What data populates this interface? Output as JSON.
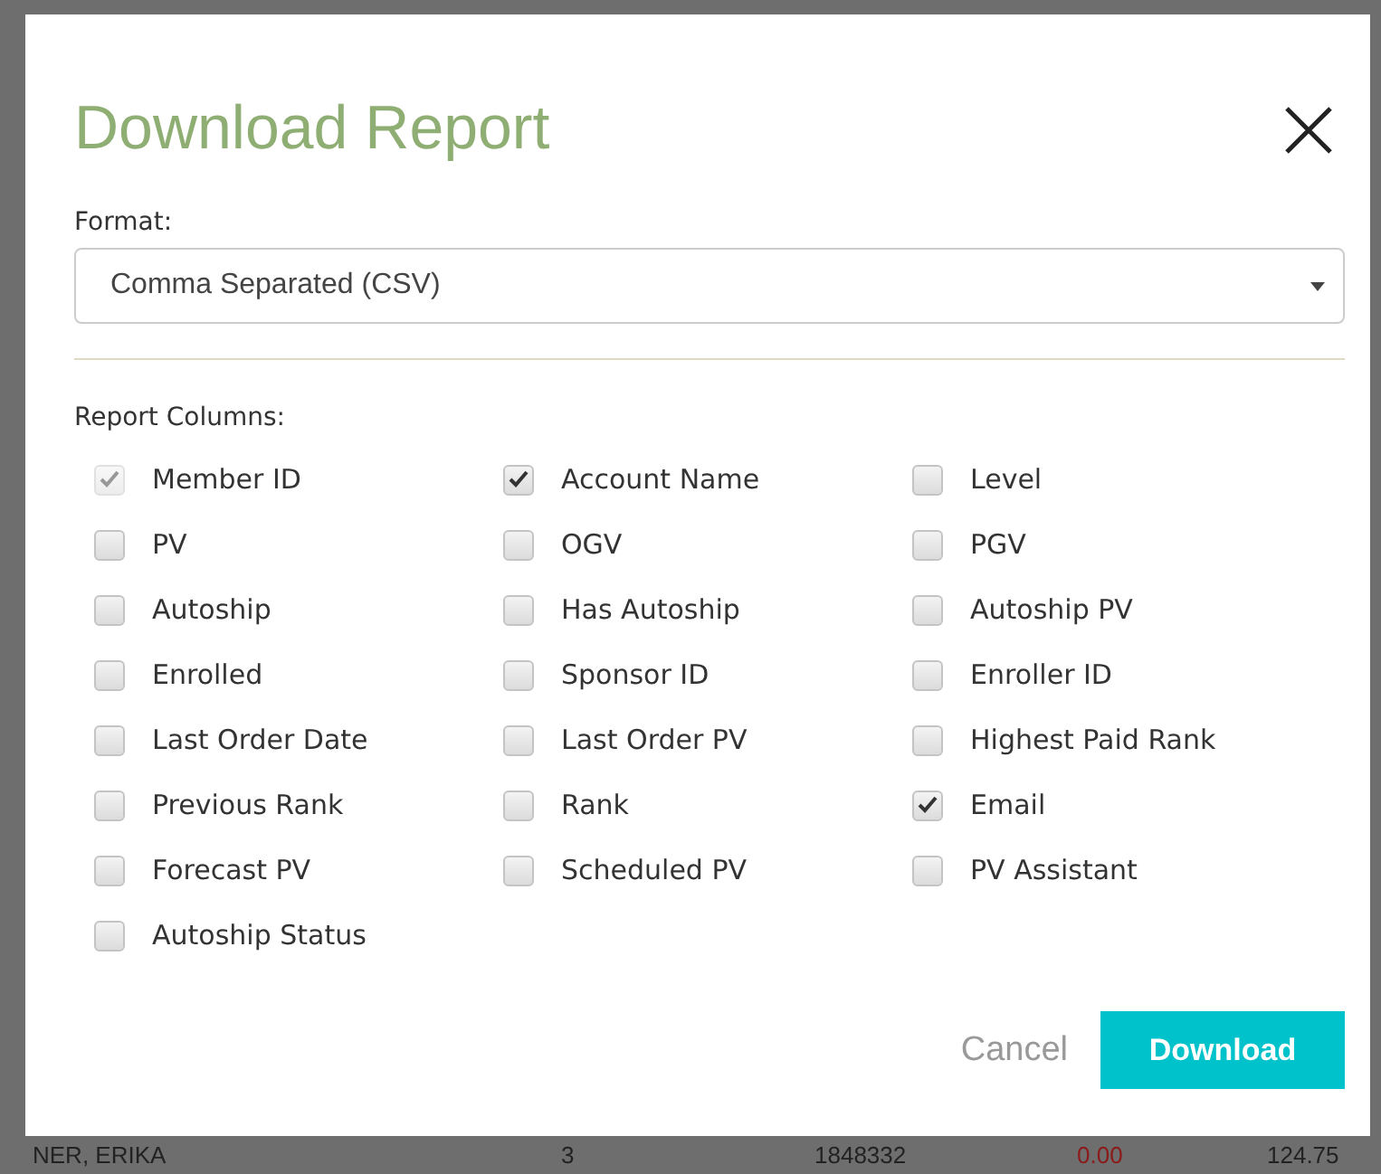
{
  "dialog": {
    "title": "Download Report",
    "format_label": "Format:",
    "format_value": "Comma Separated (CSV)",
    "columns_label": "Report Columns:",
    "columns": [
      {
        "label": "Member ID",
        "checked": true,
        "disabled": true
      },
      {
        "label": "Account Name",
        "checked": true,
        "disabled": false
      },
      {
        "label": "Level",
        "checked": false,
        "disabled": false
      },
      {
        "label": "PV",
        "checked": false,
        "disabled": false
      },
      {
        "label": "OGV",
        "checked": false,
        "disabled": false
      },
      {
        "label": "PGV",
        "checked": false,
        "disabled": false
      },
      {
        "label": "Autoship",
        "checked": false,
        "disabled": false
      },
      {
        "label": "Has Autoship",
        "checked": false,
        "disabled": false
      },
      {
        "label": "Autoship PV",
        "checked": false,
        "disabled": false
      },
      {
        "label": "Enrolled",
        "checked": false,
        "disabled": false
      },
      {
        "label": "Sponsor ID",
        "checked": false,
        "disabled": false
      },
      {
        "label": "Enroller ID",
        "checked": false,
        "disabled": false
      },
      {
        "label": "Last Order Date",
        "checked": false,
        "disabled": false
      },
      {
        "label": "Last Order PV",
        "checked": false,
        "disabled": false
      },
      {
        "label": "Highest Paid Rank",
        "checked": false,
        "disabled": false
      },
      {
        "label": "Previous Rank",
        "checked": false,
        "disabled": false
      },
      {
        "label": "Rank",
        "checked": false,
        "disabled": false
      },
      {
        "label": "Email",
        "checked": true,
        "disabled": false
      },
      {
        "label": "Forecast PV",
        "checked": false,
        "disabled": false
      },
      {
        "label": "Scheduled PV",
        "checked": false,
        "disabled": false
      },
      {
        "label": "PV Assistant",
        "checked": false,
        "disabled": false
      },
      {
        "label": "Autoship Status",
        "checked": false,
        "disabled": false
      }
    ],
    "buttons": {
      "cancel": "Cancel",
      "download": "Download"
    }
  },
  "background_row": {
    "name": "NER, ERIKA",
    "column_2": "3",
    "column_3": "1848332",
    "column_4": "0.00",
    "column_5": "124.75"
  }
}
